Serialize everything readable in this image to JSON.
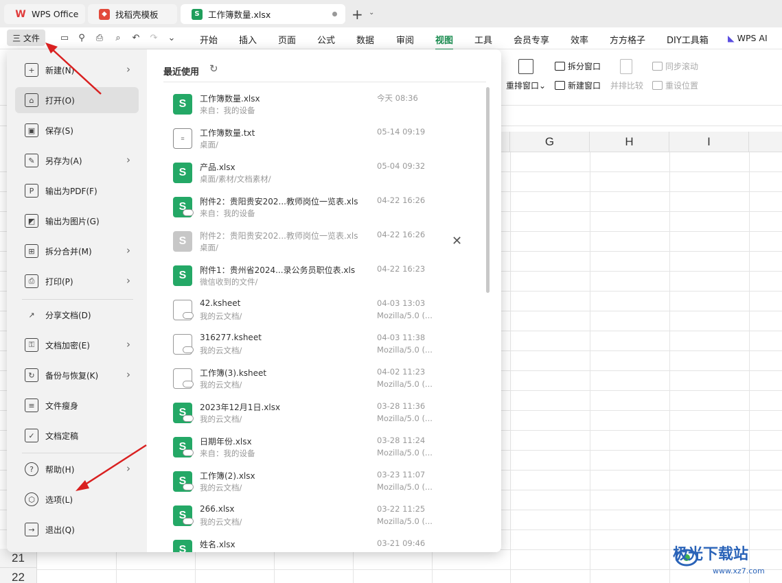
{
  "titlebar": {
    "tabs": [
      {
        "label": "WPS Office"
      },
      {
        "label": "找稻壳模板"
      },
      {
        "label": "工作簿数量.xlsx"
      }
    ],
    "new_tab": "+"
  },
  "menubar": {
    "file_label": "三 文件",
    "tabs": [
      "开始",
      "插入",
      "页面",
      "公式",
      "数据",
      "审阅",
      "视图",
      "工具",
      "会员专享",
      "效率",
      "方方格子",
      "DIY工具箱"
    ],
    "active_tab": "视图",
    "ai_label": "WPS AI"
  },
  "ribbon": {
    "tools": [
      {
        "label": "拆分窗口",
        "enabled": true
      },
      {
        "label": "同步滚动",
        "enabled": false
      },
      {
        "label": "重排窗口",
        "enabled": true
      },
      {
        "label": "新建窗口",
        "enabled": true
      },
      {
        "label": "并排比较",
        "enabled": false
      },
      {
        "label": "重设位置",
        "enabled": false
      }
    ]
  },
  "sheet": {
    "columns": [
      "G",
      "H",
      "I"
    ],
    "rows": [
      "21",
      "22"
    ]
  },
  "file_menu": {
    "items": [
      {
        "label": "新建(N)",
        "icon": "new-icon",
        "has_submenu": true
      },
      {
        "label": "打开(O)",
        "icon": "folder-icon",
        "has_submenu": false
      },
      {
        "label": "保存(S)",
        "icon": "save-icon",
        "has_submenu": false
      },
      {
        "label": "另存为(A)",
        "icon": "save-as-icon",
        "has_submenu": true
      },
      {
        "label": "输出为PDF(F)",
        "icon": "pdf-icon",
        "has_submenu": false
      },
      {
        "label": "输出为图片(G)",
        "icon": "image-icon",
        "has_submenu": false
      },
      {
        "label": "拆分合并(M)",
        "icon": "split-icon",
        "has_submenu": true
      },
      {
        "label": "打印(P)",
        "icon": "print-icon",
        "has_submenu": true
      },
      {
        "label": "分享文档(D)",
        "icon": "share-icon",
        "has_submenu": false
      },
      {
        "label": "文档加密(E)",
        "icon": "lock-icon",
        "has_submenu": true
      },
      {
        "label": "备份与恢复(K)",
        "icon": "backup-icon",
        "has_submenu": true
      },
      {
        "label": "文件瘦身",
        "icon": "slim-icon",
        "has_submenu": false
      },
      {
        "label": "文档定稿",
        "icon": "finalize-icon",
        "has_submenu": false
      },
      {
        "label": "帮助(H)",
        "icon": "help-icon",
        "has_submenu": true
      },
      {
        "label": "选项(L)",
        "icon": "gear-icon",
        "has_submenu": false
      },
      {
        "label": "退出(Q)",
        "icon": "exit-icon",
        "has_submenu": false
      }
    ],
    "selected": "打开(O)"
  },
  "recent": {
    "title": "最近使用",
    "files": [
      {
        "name": "工作簿数量.xlsx",
        "path": "来自：我的设备",
        "time": "今天 08:36",
        "source": "",
        "type": "xls",
        "cloud": false
      },
      {
        "name": "工作簿数量.txt",
        "path": "桌面/",
        "time": "05-14 09:19",
        "source": "",
        "type": "txt",
        "cloud": false
      },
      {
        "name": "产品.xlsx",
        "path": "桌面/素材/文档素材/",
        "time": "05-04 09:32",
        "source": "",
        "type": "xls",
        "cloud": false
      },
      {
        "name": "附件2：贵阳贵安202...教师岗位一览表.xls",
        "path": "来自：我的设备",
        "time": "04-22 16:26",
        "source": "",
        "type": "xls",
        "cloud": true
      },
      {
        "name": "附件2：贵阳贵安202...教师岗位一览表.xls",
        "path": "桌面/",
        "time": "04-22 16:26",
        "source": "",
        "type": "xlsgray",
        "cloud": false
      },
      {
        "name": "附件1：贵州省2024...录公务员职位表.xls",
        "path": "微信收到的文件/",
        "time": "04-22 16:23",
        "source": "",
        "type": "xls",
        "cloud": false
      },
      {
        "name": "42.ksheet",
        "path": "我的云文档/",
        "time": "04-03 13:03",
        "source": "Mozilla/5.0 (...",
        "type": "ks",
        "cloud": true
      },
      {
        "name": "316277.ksheet",
        "path": "我的云文档/",
        "time": "04-03 11:38",
        "source": "Mozilla/5.0 (...",
        "type": "ks",
        "cloud": true
      },
      {
        "name": "工作簿(3).ksheet",
        "path": "我的云文档/",
        "time": "04-02 11:23",
        "source": "Mozilla/5.0 (...",
        "type": "ks",
        "cloud": true
      },
      {
        "name": "2023年12月1日.xlsx",
        "path": "我的云文档/",
        "time": "03-28 11:36",
        "source": "Mozilla/5.0 (...",
        "type": "xls",
        "cloud": true
      },
      {
        "name": "日期年份.xlsx",
        "path": "来自：我的设备",
        "time": "03-28 11:24",
        "source": "Mozilla/5.0 (...",
        "type": "xls",
        "cloud": true
      },
      {
        "name": "工作簿(2).xlsx",
        "path": "我的云文档/",
        "time": "03-23 11:07",
        "source": "Mozilla/5.0 (...",
        "type": "xls",
        "cloud": true
      },
      {
        "name": "266.xlsx",
        "path": "我的云文档/",
        "time": "03-22 11:25",
        "source": "Mozilla/5.0 (...",
        "type": "xls",
        "cloud": true
      },
      {
        "name": "姓名.xlsx",
        "path": "",
        "time": "03-21 09:46",
        "source": "",
        "type": "xls",
        "cloud": false
      }
    ]
  },
  "watermark": {
    "text": "极光下载站",
    "url": "www.xz7.com"
  }
}
